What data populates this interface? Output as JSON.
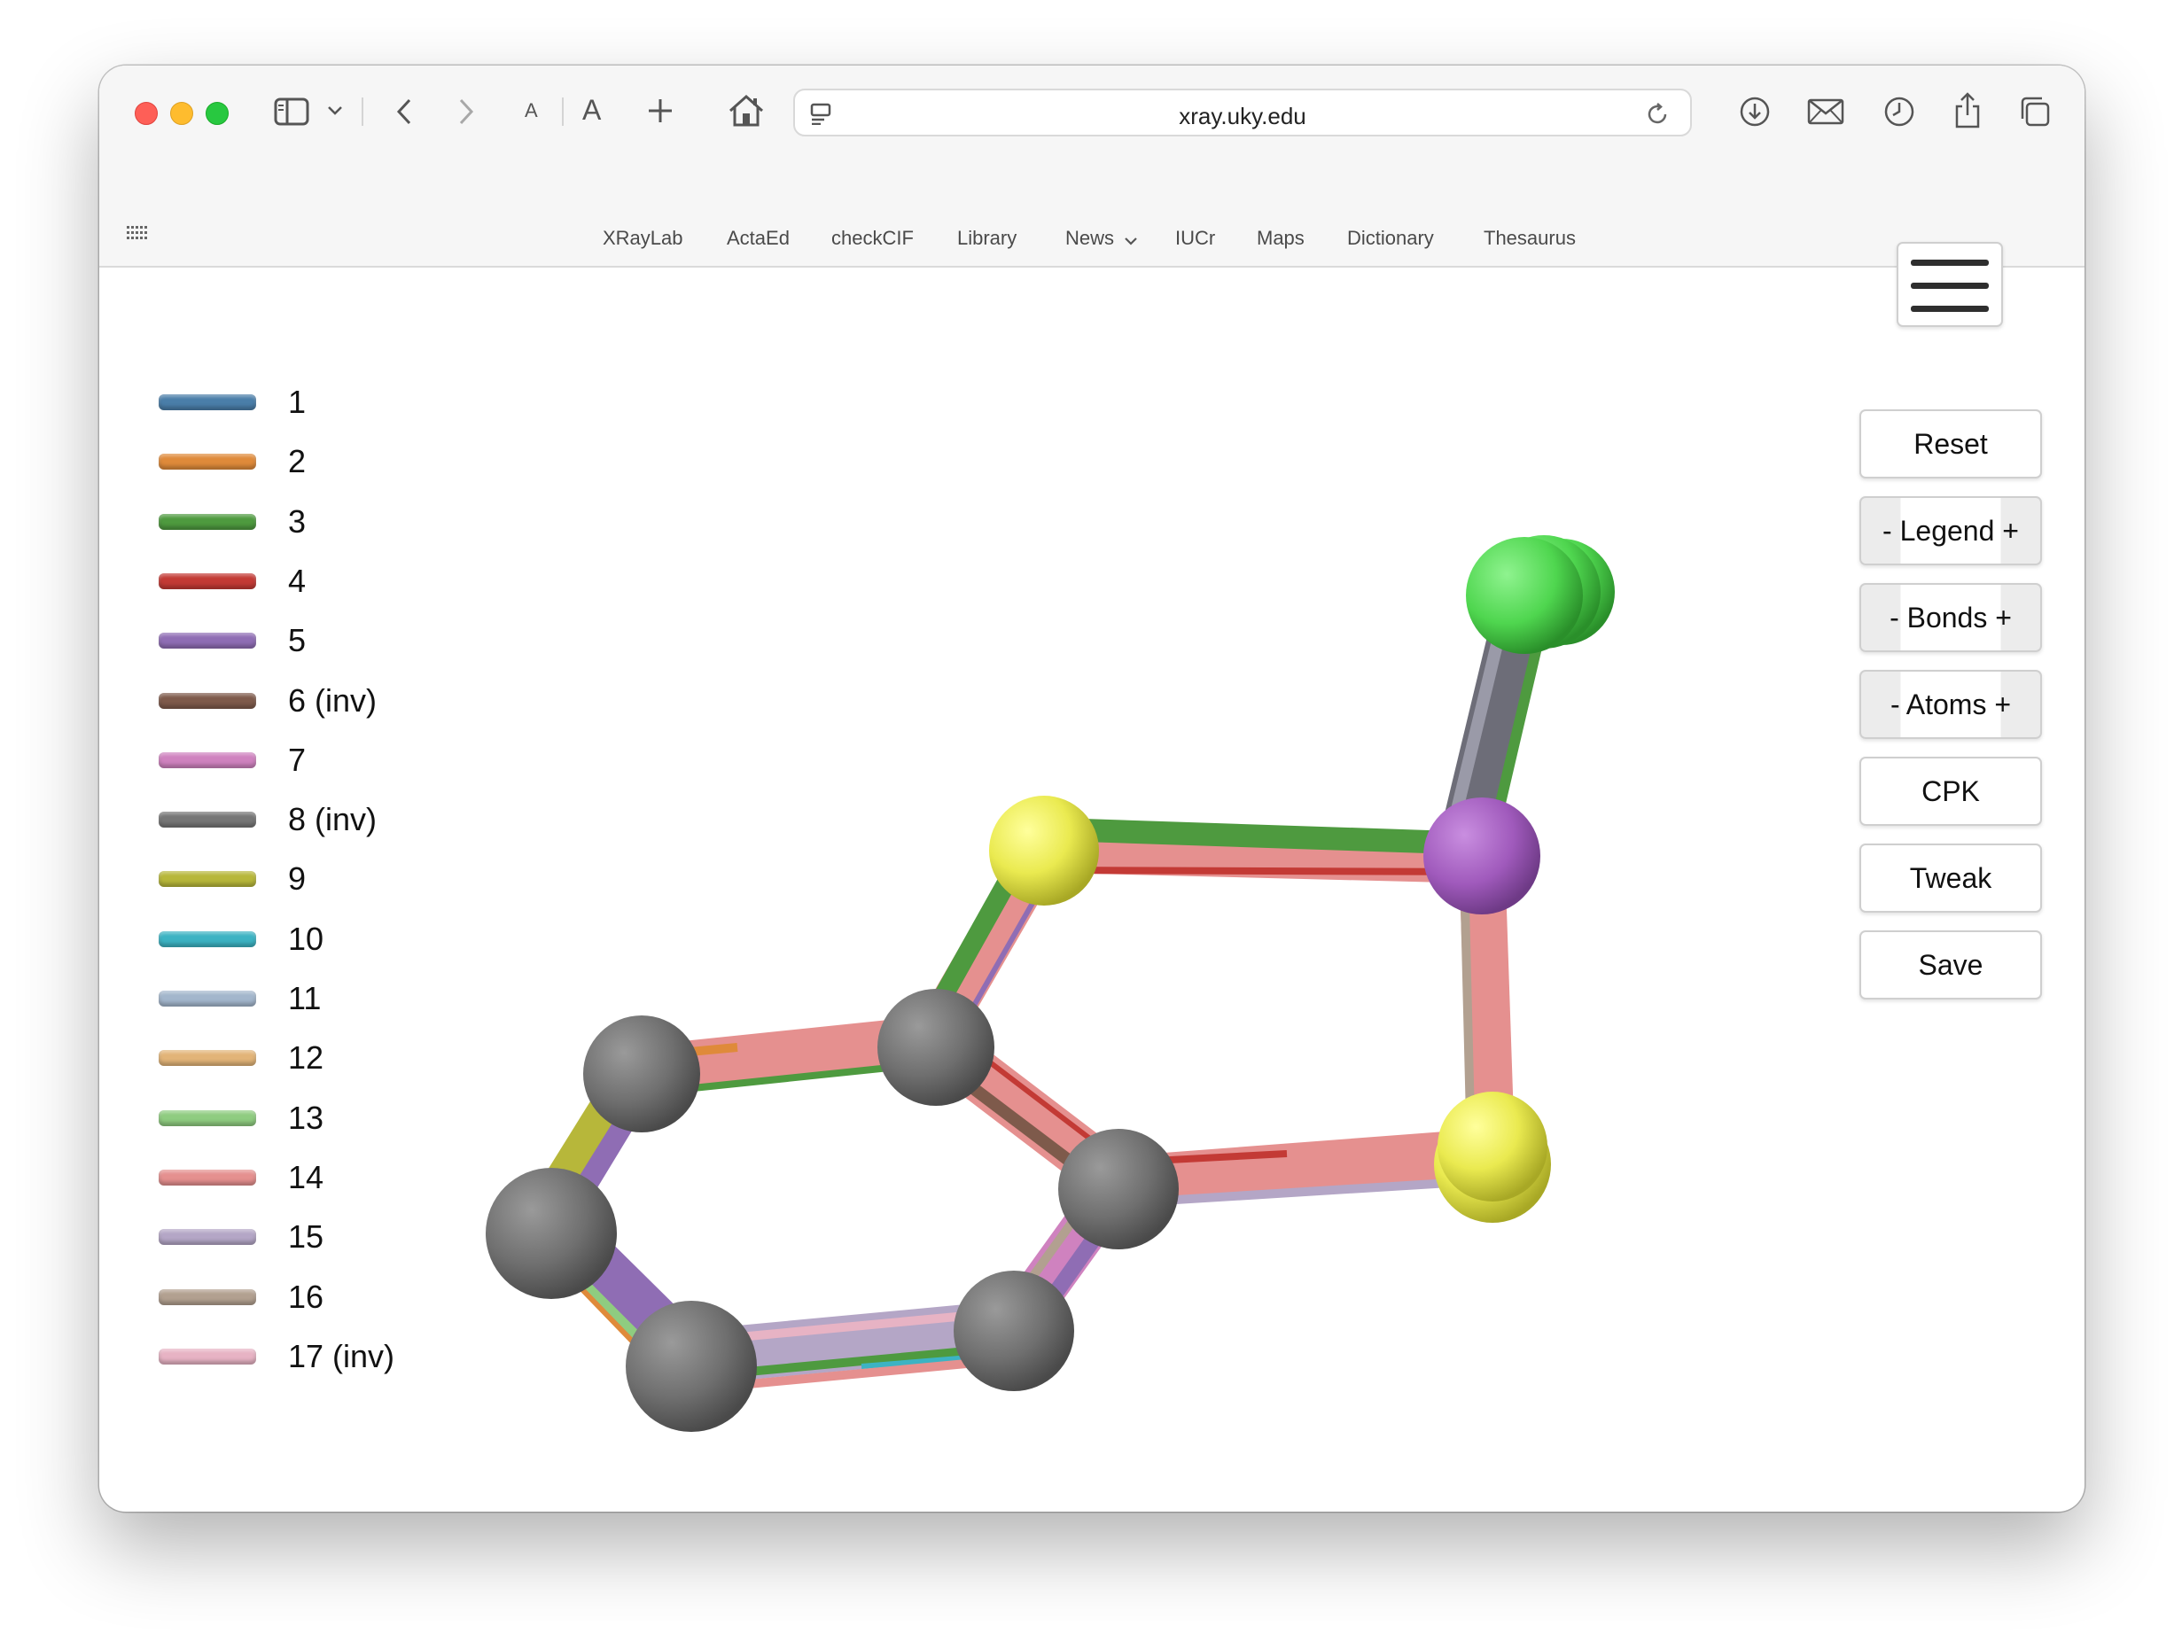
{
  "browser": {
    "url": "xray.uky.edu",
    "bookmarks": [
      "XRayLab",
      "ActaEd",
      "checkCIF",
      "Library",
      "News",
      "IUCr",
      "Maps",
      "Dictionary",
      "Thesaurus"
    ],
    "text_size_small": "A",
    "text_size_large": "A",
    "traffic_light_colors": [
      "#fe5f57",
      "#febc2e",
      "#28c840"
    ]
  },
  "legend": {
    "items": [
      {
        "label": "1",
        "color": "#4a7ea9"
      },
      {
        "label": "2",
        "color": "#df8a3a"
      },
      {
        "label": "3",
        "color": "#4e9a3f"
      },
      {
        "label": "4",
        "color": "#c33a35"
      },
      {
        "label": "5",
        "color": "#8f6db4"
      },
      {
        "label": "6 (inv)",
        "color": "#7e5a4b"
      },
      {
        "label": "7",
        "color": "#cf82bf"
      },
      {
        "label": "8 (inv)",
        "color": "#767676"
      },
      {
        "label": "9",
        "color": "#b7b73a"
      },
      {
        "label": "10",
        "color": "#3cb3c3"
      },
      {
        "label": "11",
        "color": "#a3b6cc"
      },
      {
        "label": "12",
        "color": "#e2b478"
      },
      {
        "label": "13",
        "color": "#8fcc80"
      },
      {
        "label": "14",
        "color": "#e5908f"
      },
      {
        "label": "15",
        "color": "#b4a6c6"
      },
      {
        "label": "16",
        "color": "#b2a090"
      },
      {
        "label": "17 (inv)",
        "color": "#e7b3c4"
      }
    ]
  },
  "controls": {
    "reset": "Reset",
    "legend": "- Legend +",
    "bonds": "- Bonds +",
    "atoms": "- Atoms +",
    "cpk": "CPK",
    "tweak": "Tweak",
    "save": "Save"
  },
  "molecule": {
    "atom_colors": {
      "carbon": "#7a7a7a",
      "sulfur": "#ecec55",
      "phosphorus": "#a45cbf",
      "chlorine": "#55dd55"
    }
  }
}
